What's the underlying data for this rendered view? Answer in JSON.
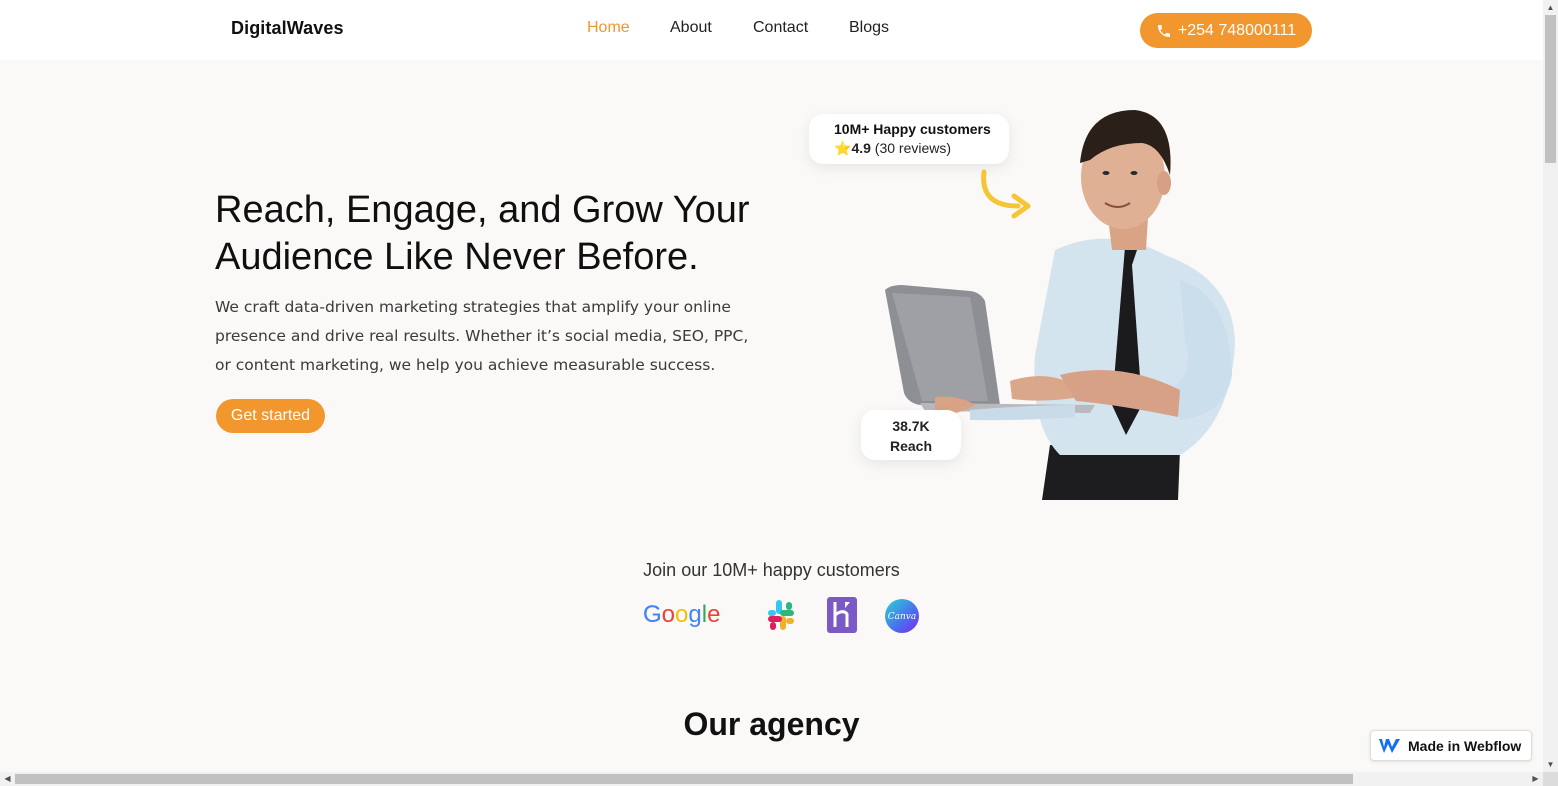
{
  "header": {
    "brand": "DigitalWaves",
    "nav": [
      {
        "label": "Home",
        "active": true
      },
      {
        "label": "About",
        "active": false
      },
      {
        "label": "Contact",
        "active": false
      },
      {
        "label": "Blogs",
        "active": false
      }
    ],
    "phone": "+254 748000111",
    "phone_icon": "phone-icon"
  },
  "hero": {
    "title": "Reach, Engage, and Grow Your Audience Like Never Before.",
    "description": "We craft data-driven marketing strategies that amplify your online presence and drive real results. Whether it’s social media, SEO, PPC, or content marketing, we help you achieve measurable success.",
    "cta": "Get started",
    "badge_customers": {
      "title": "10M+ Happy customers",
      "star": "⭐",
      "rating": "4.9",
      "reviews": "(30 reviews)"
    },
    "badge_reach": {
      "value": "38.7K",
      "label": "Reach"
    }
  },
  "customers": {
    "heading": "Join our 10M+ happy customers",
    "logos": [
      "Google",
      "slack-logo",
      "heroku-logo",
      "Canva"
    ]
  },
  "agency": {
    "heading": "Our agency"
  },
  "webflow_badge": "Made in Webflow",
  "colors": {
    "accent": "#f2962e",
    "background": "#faf9f7"
  }
}
